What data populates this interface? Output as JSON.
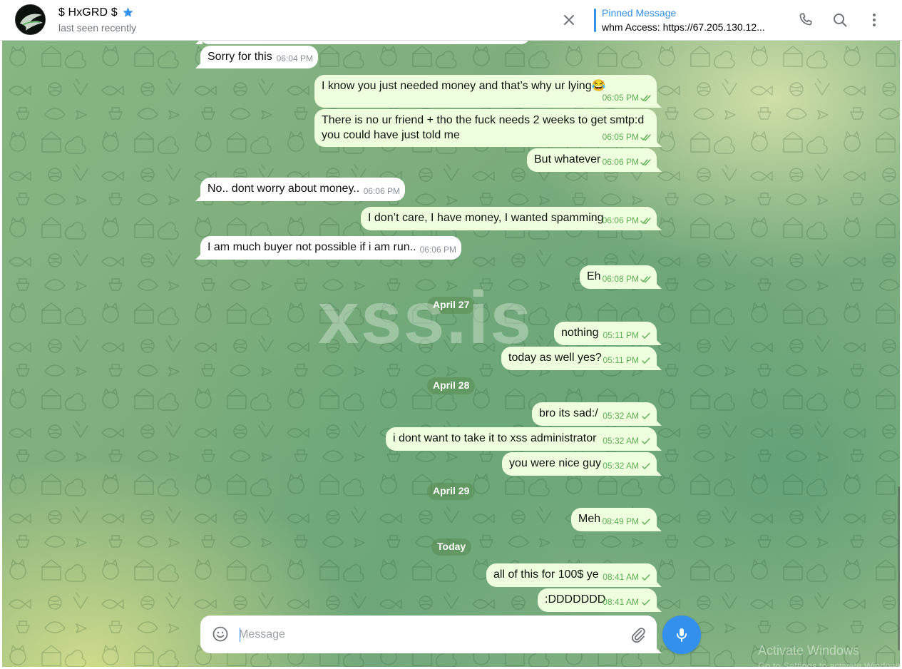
{
  "header": {
    "peer_name": "$ HxGRD $",
    "peer_status": "last seen recently",
    "pinned_title": "Pinned Message",
    "pinned_text": "whm Access: https://67.205.130.12..."
  },
  "icons": [
    "avatar",
    "star-icon",
    "close-icon",
    "phone-icon",
    "search-icon",
    "more-vertical-icon",
    "emoji-icon",
    "attach-icon",
    "mic-icon",
    "check-icon",
    "double-check-icon"
  ],
  "colors": {
    "accent": "#3390ec",
    "outgoing_bubble": "#eeffde",
    "incoming_bubble": "#ffffff",
    "check": "#5fae55"
  },
  "watermark": "xss.is",
  "messages": [
    {
      "text": "Sorry for this",
      "time": "06:04 PM",
      "dir": "in"
    },
    {
      "text": "I know you just needed money and that’s why ur lying😂",
      "time": "06:05 PM",
      "dir": "out",
      "read": true
    },
    {
      "text": "There is no ur friend + tho the fuck needs 2 weeks to get smtp:d",
      "text2": "you could have just told me",
      "time": "06:05 PM",
      "dir": "out",
      "read": true
    },
    {
      "text": "But whatever",
      "time": "06:06 PM",
      "dir": "out",
      "read": true
    },
    {
      "text": "No.. dont worry about money..",
      "time": "06:06 PM",
      "dir": "in"
    },
    {
      "text": "I don’t care, I have money, I wanted spamming",
      "time": "06:06 PM",
      "dir": "out",
      "read": true
    },
    {
      "text": "I am much buyer not possible if i am run..",
      "time": "06:06 PM",
      "dir": "in"
    },
    {
      "text": "Eh",
      "time": "06:08 PM",
      "dir": "out",
      "read": true
    },
    {
      "text": "nothing",
      "time": "05:11 PM",
      "dir": "out",
      "read": false
    },
    {
      "text": "today as well yes?",
      "time": "05:11 PM",
      "dir": "out",
      "read": false
    },
    {
      "text": "bro its sad:/",
      "time": "05:32 AM",
      "dir": "out",
      "read": false
    },
    {
      "text": "i dont want to take it to xss administrator",
      "time": "05:32 AM",
      "dir": "out",
      "read": false
    },
    {
      "text": "you were nice guy",
      "time": "05:32 AM",
      "dir": "out",
      "read": false
    },
    {
      "text": "Meh",
      "time": "08:49 PM",
      "dir": "out",
      "read": false
    },
    {
      "text": "all of this for 100$ ye",
      "time": "08:41 AM",
      "dir": "out",
      "read": false
    },
    {
      "text": ":DDDDDDD",
      "time": "08:41 AM",
      "dir": "out",
      "read": false
    }
  ],
  "dates": [
    "April 27",
    "April 28",
    "April 29",
    "Today"
  ],
  "composer": {
    "placeholder": "Message"
  },
  "os_overlay": {
    "title": "Activate Windows",
    "subtitle": "Go to Settings to activate Windows."
  }
}
